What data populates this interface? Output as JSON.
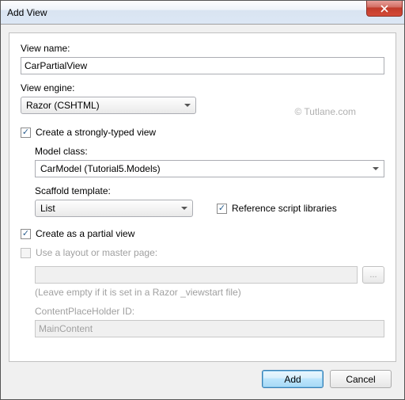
{
  "window": {
    "title": "Add View"
  },
  "watermark": "© Tutlane.com",
  "labels": {
    "view_name": "View name:",
    "view_engine": "View engine:",
    "strongly_typed": "Create a strongly-typed view",
    "model_class": "Model class:",
    "scaffold_template": "Scaffold template:",
    "ref_script": "Reference script libraries",
    "partial_view": "Create as a partial view",
    "use_layout": "Use a layout or master page:",
    "hint": "(Leave empty if it is set in a Razor _viewstart file)",
    "cph_id": "ContentPlaceHolder ID:"
  },
  "values": {
    "view_name": "CarPartialView",
    "view_engine": "Razor (CSHTML)",
    "model_class": "CarModel (Tutorial5.Models)",
    "scaffold_template": "List",
    "layout_path": "",
    "cph_id": "MainContent"
  },
  "checks": {
    "strongly_typed": true,
    "ref_script": true,
    "partial_view": true,
    "use_layout": false
  },
  "buttons": {
    "browse": "...",
    "add": "Add",
    "cancel": "Cancel"
  }
}
